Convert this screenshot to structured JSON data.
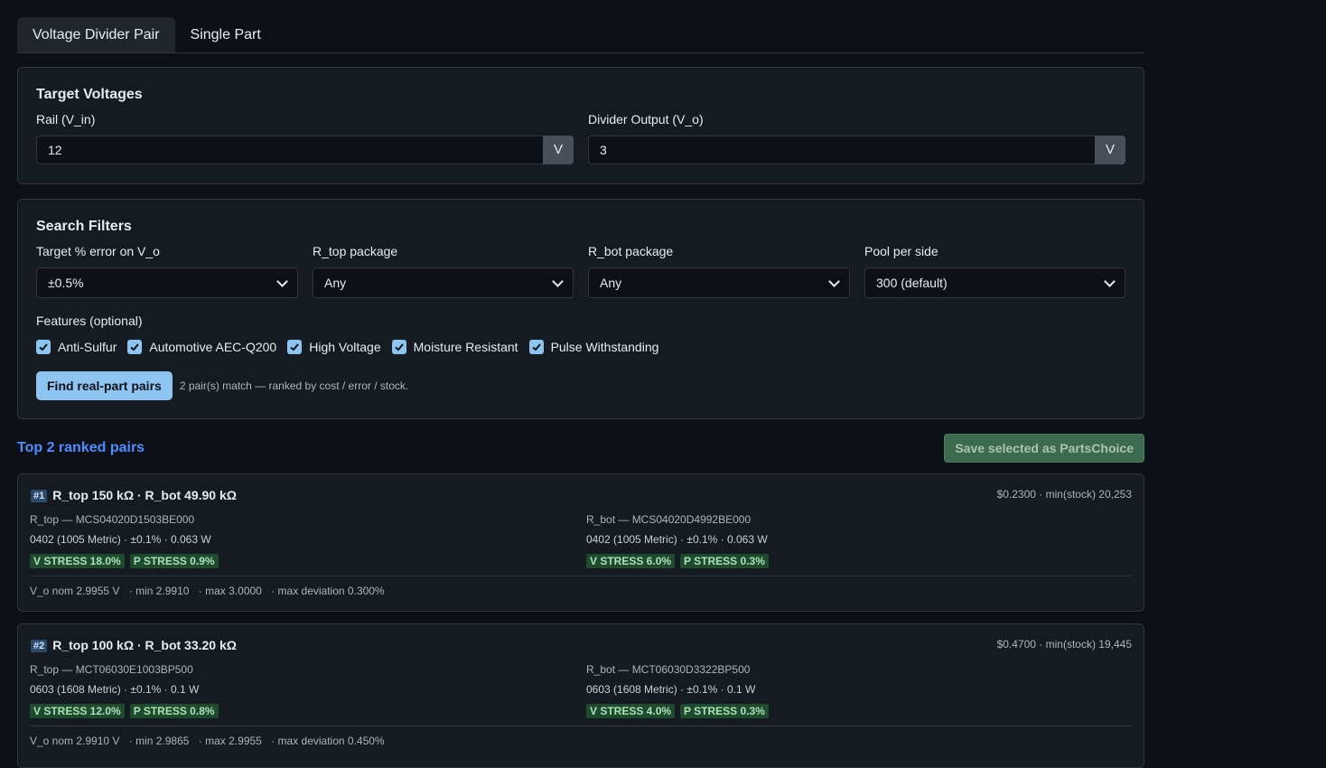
{
  "tabs": [
    {
      "label": "Voltage Divider Pair",
      "active": true
    },
    {
      "label": "Single Part",
      "active": false
    }
  ],
  "targets": {
    "title": "Target Voltages",
    "rail_label": "Rail (V_in)",
    "rail_value": "12",
    "rail_unit": "V",
    "out_label": "Divider Output (V_o)",
    "out_value": "3",
    "out_unit": "V"
  },
  "filters": {
    "title": "Search Filters",
    "error_label": "Target % error on V_o",
    "error_value": "±0.5%",
    "rtop_pkg_label": "R_top package",
    "rtop_pkg_value": "Any",
    "rbot_pkg_label": "R_bot package",
    "rbot_pkg_value": "Any",
    "pool_label": "Pool per side",
    "pool_value": "300 (default)",
    "features_label": "Features (optional)",
    "features": [
      {
        "label": "Anti-Sulfur",
        "checked": true
      },
      {
        "label": "Automotive AEC-Q200",
        "checked": true
      },
      {
        "label": "High Voltage",
        "checked": true
      },
      {
        "label": "Moisture Resistant",
        "checked": true
      },
      {
        "label": "Pulse Withstanding",
        "checked": true
      }
    ],
    "find_button": "Find real-part pairs",
    "status": "2 pair(s) match — ranked by cost / error / stock."
  },
  "results_header": {
    "title": "Top 2 ranked pairs",
    "save_button": "Save selected as PartsChoice"
  },
  "results": [
    {
      "rank": "#1",
      "title": "R_top 150 kΩ · R_bot 49.90 kΩ",
      "meta": "$0.2300 · min(stock) 20,253",
      "top": {
        "part": "R_top — MCS04020D1503BE000",
        "spec": "0402 (1005 Metric) · ±0.1% · 0.063 W",
        "v_stress": "V STRESS 18.0%",
        "p_stress": "P STRESS 0.9%"
      },
      "bot": {
        "part": "R_bot — MCS04020D4992BE000",
        "spec": "0402 (1005 Metric) · ±0.1% · 0.063 W",
        "v_stress": "V STRESS 6.0%",
        "p_stress": "P STRESS 0.3%"
      },
      "vo_nom": "V_o nom 2.9955 V",
      "vo_min": "· min 2.9910",
      "vo_max": "· max 3.0000",
      "max_dev": "· max deviation 0.300%"
    },
    {
      "rank": "#2",
      "title": "R_top 100 kΩ · R_bot 33.20 kΩ",
      "meta": "$0.4700 · min(stock) 19,445",
      "top": {
        "part": "R_top — MCT06030E1003BP500",
        "spec": "0603 (1608 Metric) · ±0.1% · 0.1 W",
        "v_stress": "V STRESS 12.0%",
        "p_stress": "P STRESS 0.8%"
      },
      "bot": {
        "part": "R_bot — MCT06030D3322BP500",
        "spec": "0603 (1608 Metric) · ±0.1% · 0.1 W",
        "v_stress": "V STRESS 4.0%",
        "p_stress": "P STRESS 0.3%"
      },
      "vo_nom": "V_o nom 2.9910 V",
      "vo_min": "· min 2.9865",
      "vo_max": "· max 2.9955",
      "max_dev": "· max deviation 0.450%"
    }
  ],
  "colors": {
    "background": "#0d1117",
    "card": "#161b22",
    "accent": "#8ec4f0",
    "section_title": "#4c8dff",
    "badge_bg": "#1f4a2e",
    "badge_text": "#a7e3b8"
  }
}
